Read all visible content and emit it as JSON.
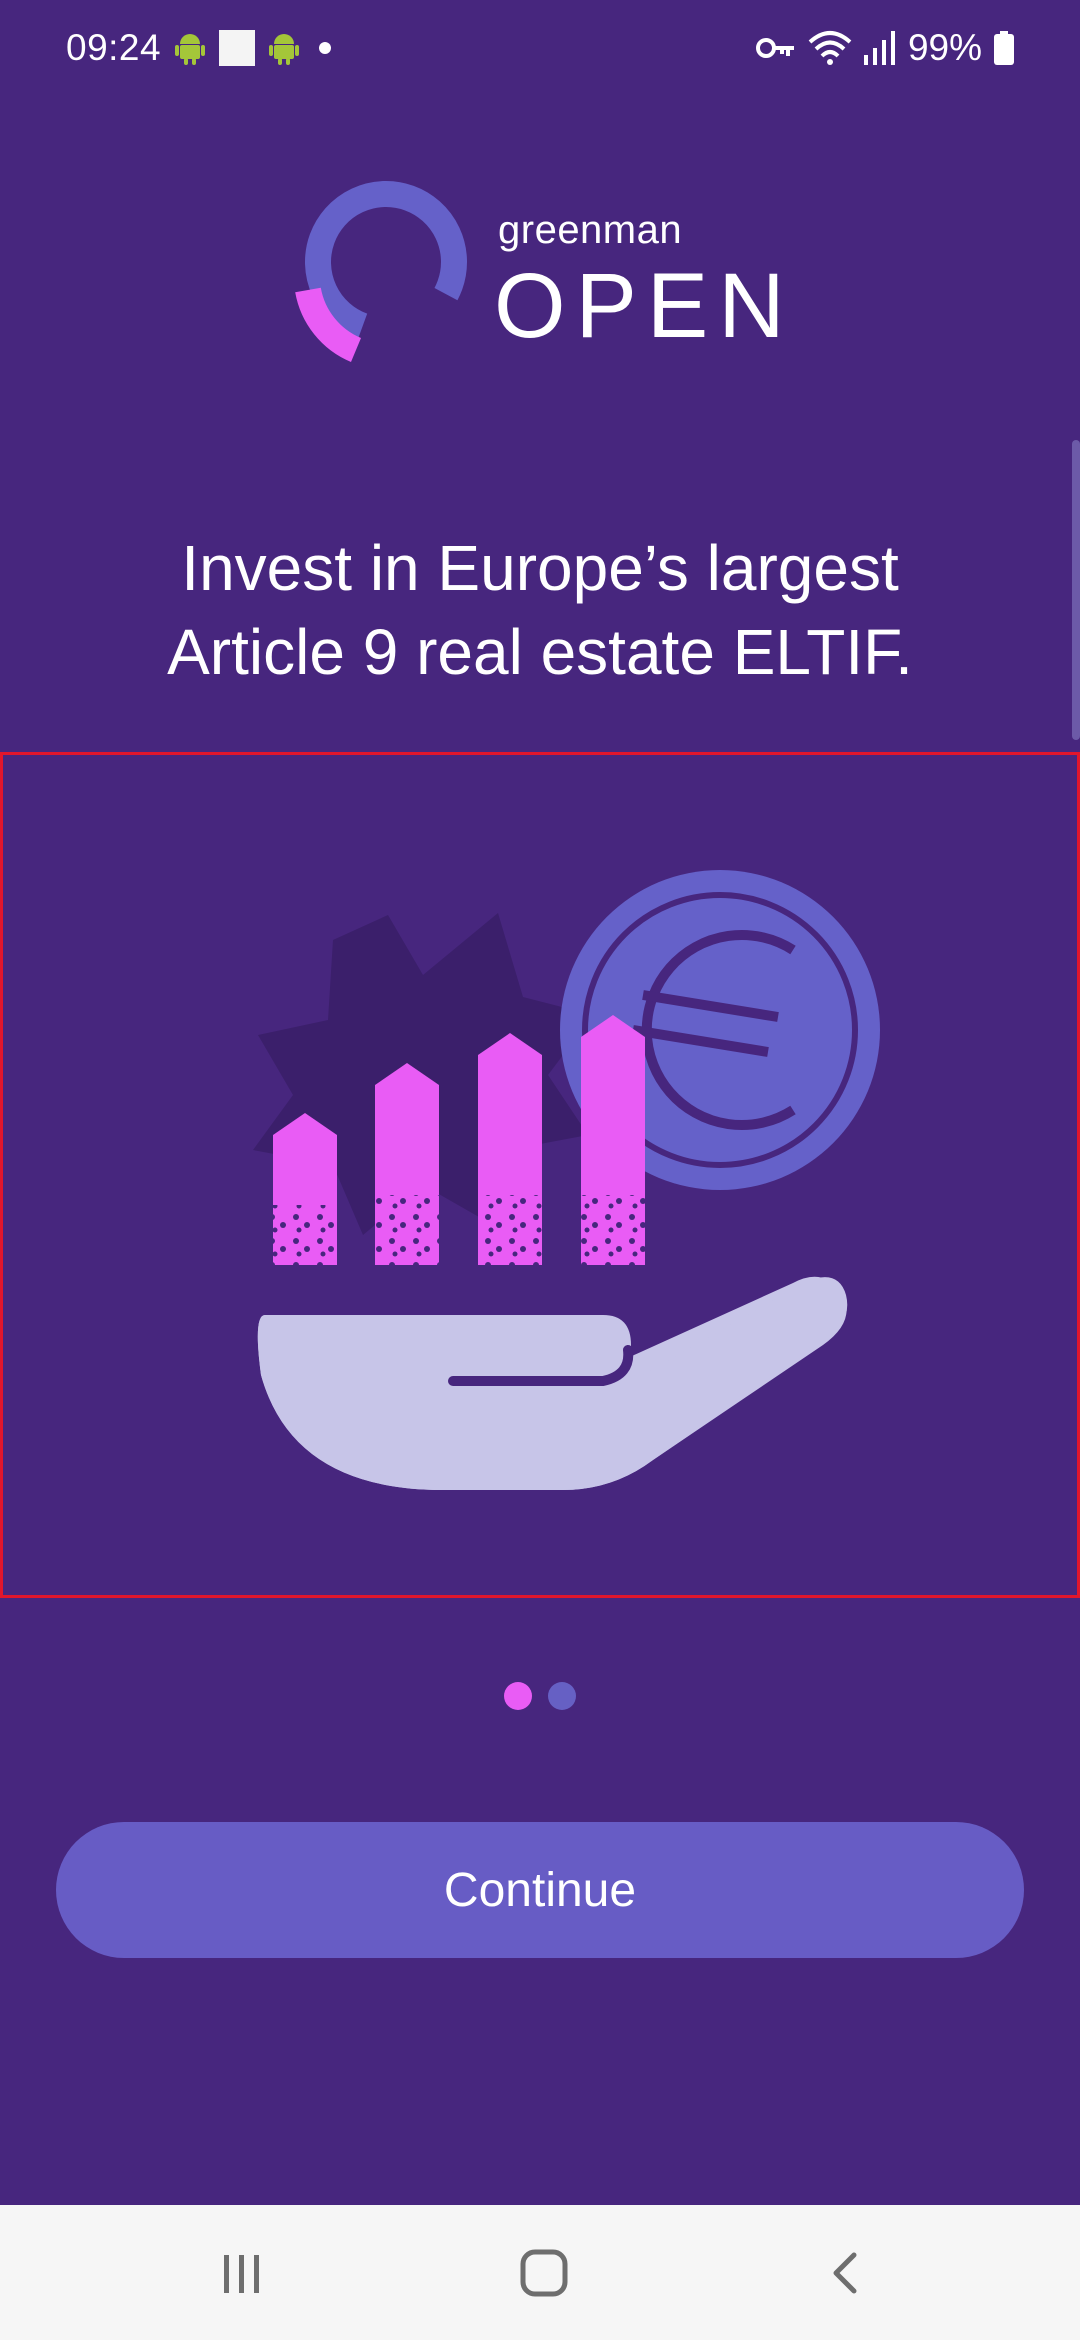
{
  "status_bar": {
    "time": "09:24",
    "battery": "99%",
    "icons": [
      "android-icon",
      "square-notification-icon",
      "android-icon",
      "dot-icon",
      "vpn-key-icon",
      "wifi-icon",
      "signal-icon",
      "battery-icon"
    ]
  },
  "logo": {
    "small": "greenman",
    "big": "OPEN"
  },
  "headline": {
    "line1": "Invest in Europe’s largest",
    "line2": "Article 9 real estate ELTIF."
  },
  "illustration": {
    "icons": [
      "star-burst-icon",
      "euro-coin-icon",
      "bar-growth-icon",
      "open-hand-icon"
    ]
  },
  "pager": {
    "count": 2,
    "active_index": 0
  },
  "continue_label": "Continue",
  "nav_bar": {
    "icons": [
      "recent-apps-icon",
      "home-icon",
      "back-icon"
    ]
  },
  "colors": {
    "background": "#47267e",
    "accent_pink": "#e95cf5",
    "accent_purple": "#675cc5",
    "hand": "#c7c5e8"
  }
}
